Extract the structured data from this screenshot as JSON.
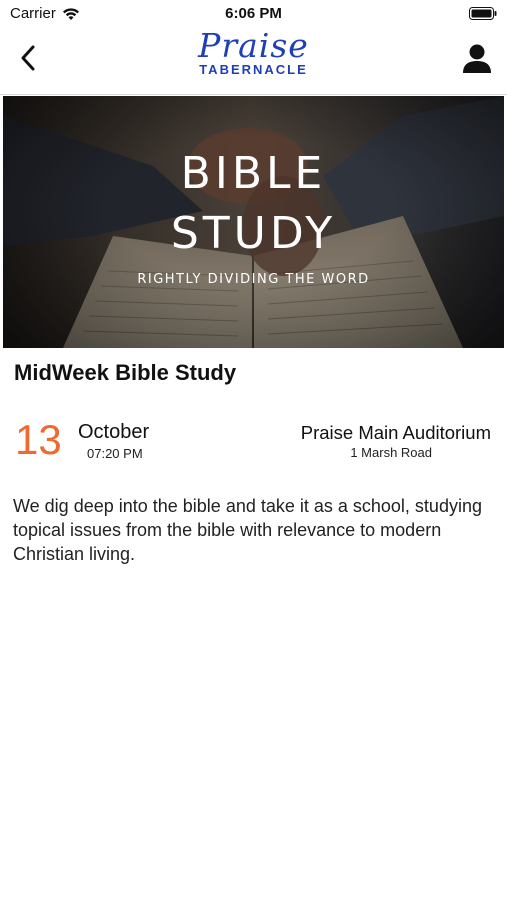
{
  "status_bar": {
    "carrier": "Carrier",
    "time": "6:06 PM"
  },
  "nav": {
    "logo_script": "Praise",
    "logo_sub": "TABERNACLE",
    "back_icon": "chevron-left-icon",
    "profile_icon": "user-icon"
  },
  "banner": {
    "title_line1": "BIBLE",
    "title_line2": "STUDY",
    "subtitle": "RIGHTLY DIVIDING THE WORD"
  },
  "event": {
    "title": "MidWeek Bible Study",
    "day": "13",
    "month": "October",
    "time": "07:20 PM",
    "venue": "Praise Main Auditorium",
    "address": "1 Marsh Road",
    "description": "We dig deep into the bible and take it as a school, studying topical issues from the bible with relevance to modern Christian living."
  },
  "colors": {
    "accent_date": "#ef6a2e",
    "brand_blue": "#1f3fb6"
  }
}
